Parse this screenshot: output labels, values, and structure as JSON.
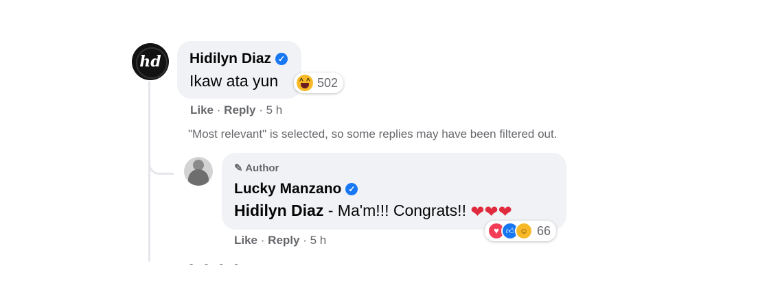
{
  "comment": {
    "author": "Hidilyn Diaz",
    "verified_icon": "verified-check-icon",
    "text": "Ikaw ata yun",
    "reaction": {
      "icon": "haha-emoji-icon",
      "count": "502"
    },
    "actions": {
      "like": "Like",
      "reply": "Reply",
      "time": "5 h",
      "separator": "·"
    }
  },
  "filter_note": "\"Most relevant\" is selected, so some replies may have been filtered out.",
  "reply": {
    "badge_icon": "pencil-icon",
    "badge": "Author",
    "author": "Lucky Manzano",
    "verified_icon": "verified-check-icon",
    "mention": "Hidilyn Diaz",
    "text": " - Ma'm!!! Congrats!! ",
    "hearts": "❤❤❤",
    "reaction": {
      "icons": [
        "love-emoji-icon",
        "like-emoji-icon",
        "care-emoji-icon"
      ],
      "count": "66"
    },
    "actions": {
      "like": "Like",
      "reply": "Reply",
      "time": "5 h",
      "separator": "·"
    }
  },
  "colors": {
    "bubble": "#f0f2f5",
    "secondary_text": "#65676b",
    "verified": "#1877f2",
    "heart": "#e02a3d"
  }
}
